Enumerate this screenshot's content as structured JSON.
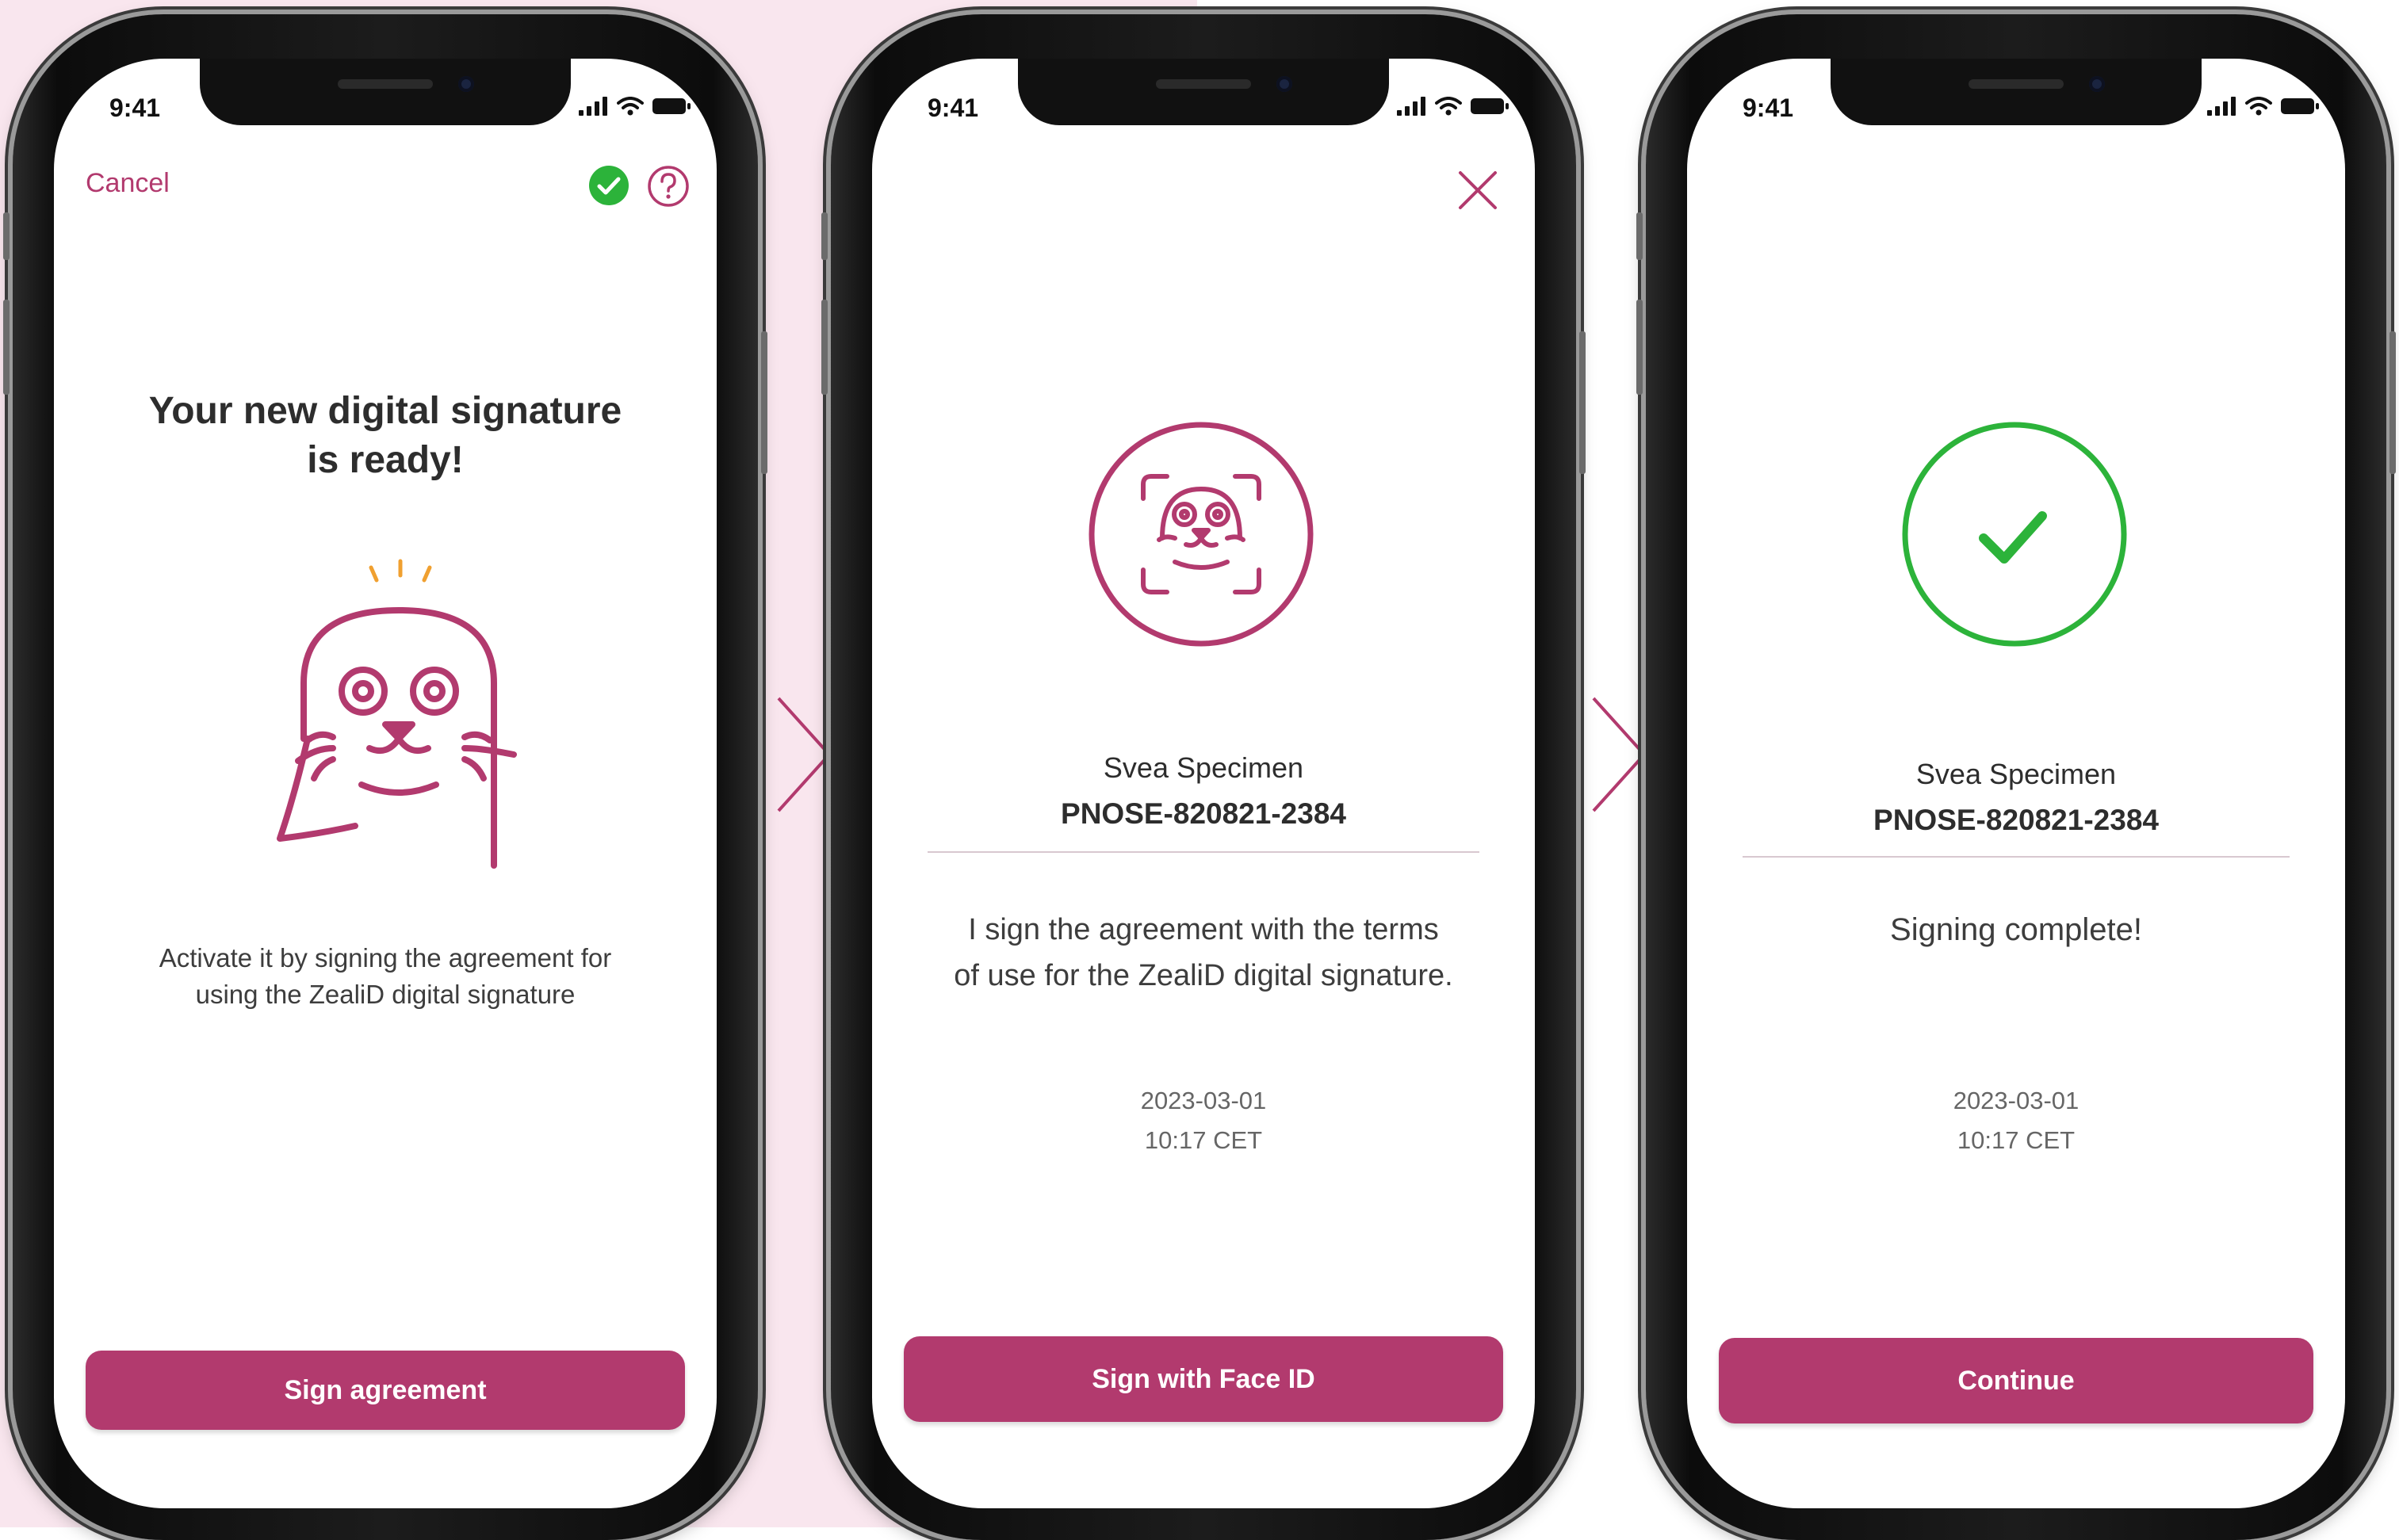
{
  "colors": {
    "brand": "#b23a6e",
    "success": "#2cb33a",
    "spark": "#f0a030",
    "page_tint": "#f9e6ee"
  },
  "screens": [
    {
      "status_time": "9:41",
      "cancel_label": "Cancel",
      "status_check_icon": "check-circle-icon",
      "help_icon": "question-circle-icon",
      "title_line1": "Your new digital signature",
      "title_line2": "is ready!",
      "mascot_icon": "seal-mascot-icon",
      "desc_line1": "Activate it by signing the agreement for",
      "desc_line2": "using the ZealiD digital signature",
      "button_label": "Sign agreement"
    },
    {
      "status_time": "9:41",
      "close_icon": "close-icon",
      "face_icon": "face-id-seal-icon",
      "name": "Svea Specimen",
      "id": "PNOSE-820821-2384",
      "message_line1": "I sign the agreement with the terms",
      "message_line2": "of use for the ZealiD digital signature.",
      "date": "2023-03-01",
      "time": "10:17 CET",
      "button_label": "Sign with Face ID"
    },
    {
      "status_time": "9:41",
      "success_icon": "check-circle-icon",
      "name": "Svea Specimen",
      "id": "PNOSE-820821-2384",
      "message": "Signing complete!",
      "date": "2023-03-01",
      "time": "10:17 CET",
      "button_label": "Continue"
    }
  ],
  "flow_arrow_icon": "chevron-right-icon"
}
